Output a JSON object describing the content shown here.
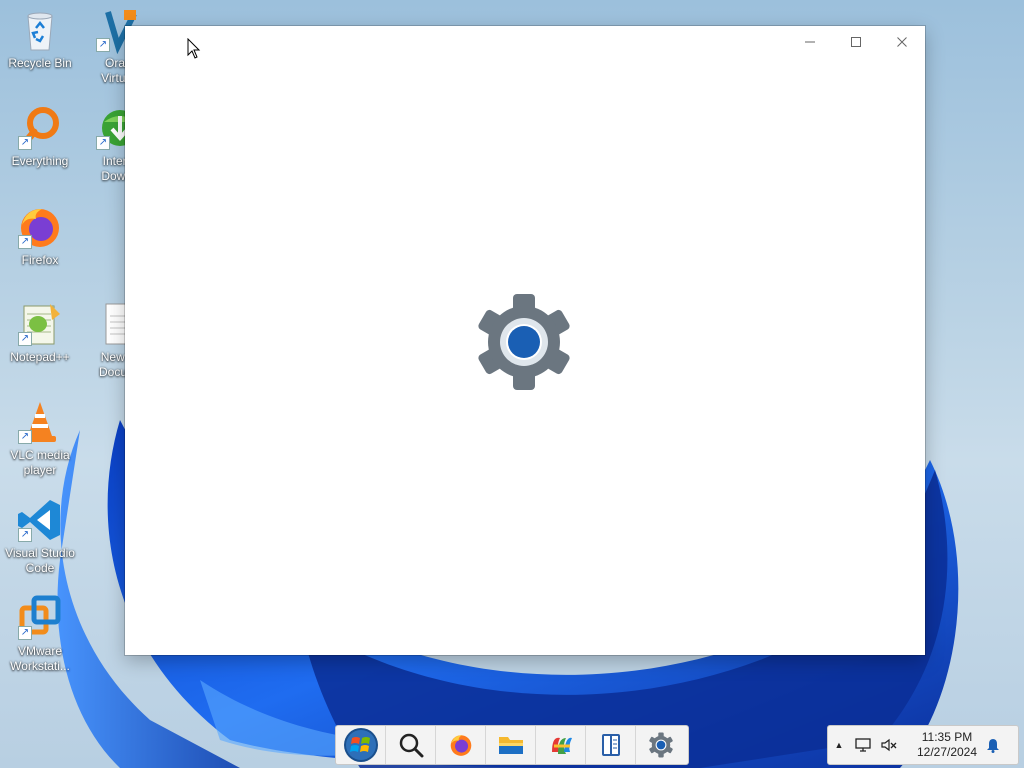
{
  "desktop": {
    "icons": [
      {
        "label": "Recycle Bin",
        "icon": "recycle-bin-icon"
      },
      {
        "label": "Oracle VirtualBox",
        "label_line1": "Orac",
        "label_line2": "Virtual",
        "icon": "virtualbox-icon"
      },
      {
        "label": "Everything",
        "icon": "everything-icon"
      },
      {
        "label": "Internet Download Manager",
        "label_line1": "Intern",
        "label_line2": "Downl",
        "icon": "idm-icon"
      },
      {
        "label": "Firefox",
        "icon": "firefox-icon"
      },
      {
        "label": "Notepad++",
        "icon": "notepadpp-icon"
      },
      {
        "label": "New Text Document",
        "label_line1": "New T",
        "label_line2": "Docum",
        "icon": "text-document-icon"
      },
      {
        "label_line1": "VLC media",
        "label_line2": "player",
        "icon": "vlc-icon"
      },
      {
        "label_line1": "Visual Studio",
        "label_line2": "Code",
        "icon": "vscode-icon"
      },
      {
        "label_line1": "VMware",
        "label_line2": "Workstati...",
        "icon": "vmware-icon"
      }
    ]
  },
  "window": {
    "app": "Settings",
    "controls": {
      "minimize": "—",
      "maximize": "☐",
      "close": "✕"
    },
    "splash_icon": "settings-gear-icon"
  },
  "taskbar": {
    "buttons": [
      {
        "name": "start-button",
        "icon": "windows-start-orb-icon"
      },
      {
        "name": "search-button",
        "icon": "search-icon"
      },
      {
        "name": "firefox-taskbar-button",
        "icon": "firefox-icon"
      },
      {
        "name": "file-explorer-taskbar-button",
        "icon": "folder-icon"
      },
      {
        "name": "app-taskbar-button",
        "icon": "colorful-app-icon"
      },
      {
        "name": "book-taskbar-button",
        "icon": "book-icon"
      },
      {
        "name": "settings-taskbar-button",
        "icon": "gear-icon"
      }
    ]
  },
  "tray": {
    "overflow": "▲",
    "time": "11:35 PM",
    "date": "12/27/2024"
  },
  "colors": {
    "accent": "#1a5fb4",
    "gear": "#6b7680",
    "taskbar_bg": "#f3f3f3"
  }
}
